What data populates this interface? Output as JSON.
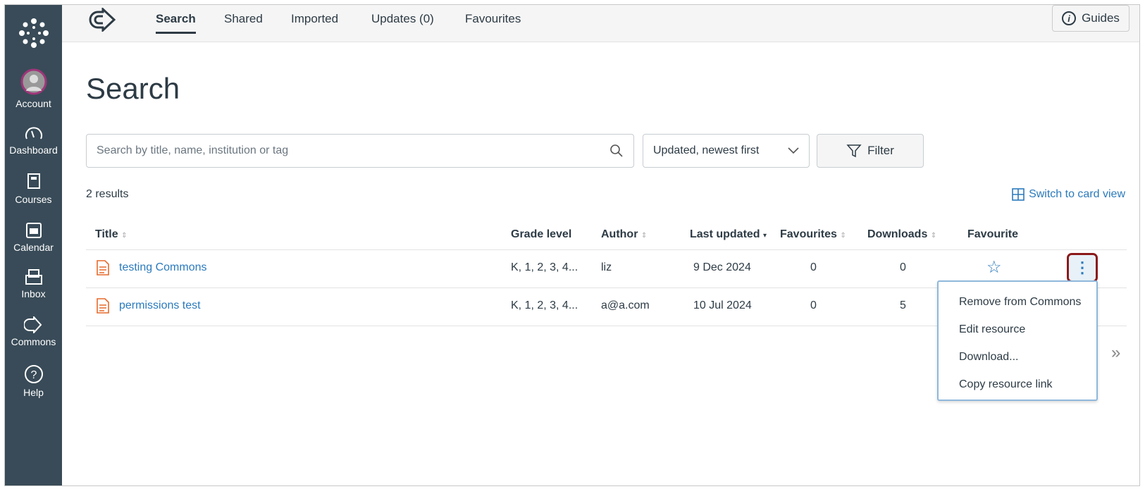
{
  "sidebar": {
    "items": [
      {
        "label": "Account"
      },
      {
        "label": "Dashboard"
      },
      {
        "label": "Courses"
      },
      {
        "label": "Calendar"
      },
      {
        "label": "Inbox"
      },
      {
        "label": "Commons"
      },
      {
        "label": "Help"
      }
    ]
  },
  "topnav": {
    "tabs": [
      "Search",
      "Shared",
      "Imported",
      "Updates (0)",
      "Favourites"
    ],
    "guides": "Guides"
  },
  "page": {
    "title": "Search",
    "search_placeholder": "Search by title, name, institution or tag",
    "sort": "Updated, newest first",
    "filter": "Filter",
    "results": "2 results",
    "switch_view": "Switch to card view"
  },
  "table": {
    "headers": [
      "Title",
      "Grade level",
      "Author",
      "Last updated",
      "Favourites",
      "Downloads",
      "Favourite"
    ],
    "rows": [
      {
        "title": "testing Commons",
        "grade": "K, 1, 2, 3, 4...",
        "author": "liz",
        "updated": "9 Dec 2024",
        "favourites": "0",
        "downloads": "0"
      },
      {
        "title": "permissions test",
        "grade": "K, 1, 2, 3, 4...",
        "author": "a@a.com",
        "updated": "10 Jul 2024",
        "favourites": "0",
        "downloads": "5"
      }
    ]
  },
  "menu": {
    "items": [
      "Remove from Commons",
      "Edit resource",
      "Download...",
      "Copy resource link"
    ]
  },
  "colors": {
    "sidebar": "#394b58",
    "link": "#2b7abc",
    "highlight": "#8b1a1a"
  }
}
